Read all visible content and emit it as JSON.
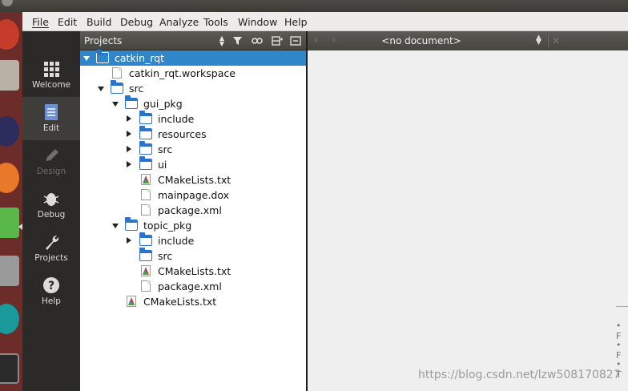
{
  "menu": [
    "File",
    "Edit",
    "Build",
    "Debug",
    "Analyze",
    "Tools",
    "Window",
    "Help"
  ],
  "modes": [
    {
      "label": "Welcome",
      "icon": "grid-icon",
      "enabled": true,
      "active": false
    },
    {
      "label": "Edit",
      "icon": "document-icon",
      "enabled": true,
      "active": true
    },
    {
      "label": "Design",
      "icon": "pencil-icon",
      "enabled": false,
      "active": false
    },
    {
      "label": "Debug",
      "icon": "bug-icon",
      "enabled": true,
      "active": false
    },
    {
      "label": "Projects",
      "icon": "wrench-icon",
      "enabled": true,
      "active": false
    },
    {
      "label": "Help",
      "icon": "help-icon",
      "enabled": true,
      "active": false
    }
  ],
  "projects": {
    "title": "Projects",
    "tree": [
      {
        "label": "catkin_rqt",
        "type": "project",
        "depth": 0,
        "expander": "open",
        "selected": true
      },
      {
        "label": "catkin_rqt.workspace",
        "type": "file",
        "depth": 1,
        "expander": "none"
      },
      {
        "label": "src",
        "type": "folder",
        "depth": 1,
        "expander": "open"
      },
      {
        "label": "gui_pkg",
        "type": "folder",
        "depth": 2,
        "expander": "open"
      },
      {
        "label": "include",
        "type": "folder",
        "depth": 3,
        "expander": "closed"
      },
      {
        "label": "resources",
        "type": "folder",
        "depth": 3,
        "expander": "closed"
      },
      {
        "label": "src",
        "type": "folder",
        "depth": 3,
        "expander": "closed"
      },
      {
        "label": "ui",
        "type": "folder",
        "depth": 3,
        "expander": "closed"
      },
      {
        "label": "CMakeLists.txt",
        "type": "cmake",
        "depth": 3,
        "expander": "none"
      },
      {
        "label": "mainpage.dox",
        "type": "file",
        "depth": 3,
        "expander": "none"
      },
      {
        "label": "package.xml",
        "type": "file",
        "depth": 3,
        "expander": "none"
      },
      {
        "label": "topic_pkg",
        "type": "folder",
        "depth": 2,
        "expander": "open"
      },
      {
        "label": "include",
        "type": "folder",
        "depth": 3,
        "expander": "closed"
      },
      {
        "label": "src",
        "type": "folder",
        "depth": 3,
        "expander": "none"
      },
      {
        "label": "CMakeLists.txt",
        "type": "cmake",
        "depth": 3,
        "expander": "none"
      },
      {
        "label": "package.xml",
        "type": "file",
        "depth": 3,
        "expander": "none"
      },
      {
        "label": "CMakeLists.txt",
        "type": "cmake",
        "depth": 2,
        "expander": "none"
      }
    ]
  },
  "editor": {
    "document": "<no document>",
    "back": "‹",
    "forward": "›",
    "close": "✕",
    "bullets": [
      "• F",
      "• F",
      "• T"
    ]
  },
  "watermark": "https://blog.csdn.net/lzw508170827",
  "colors": {
    "selection": "#2f86c8",
    "folder": "#2a74c9",
    "modebar": "#2b2a28",
    "launcher": "#6b2c2a"
  }
}
